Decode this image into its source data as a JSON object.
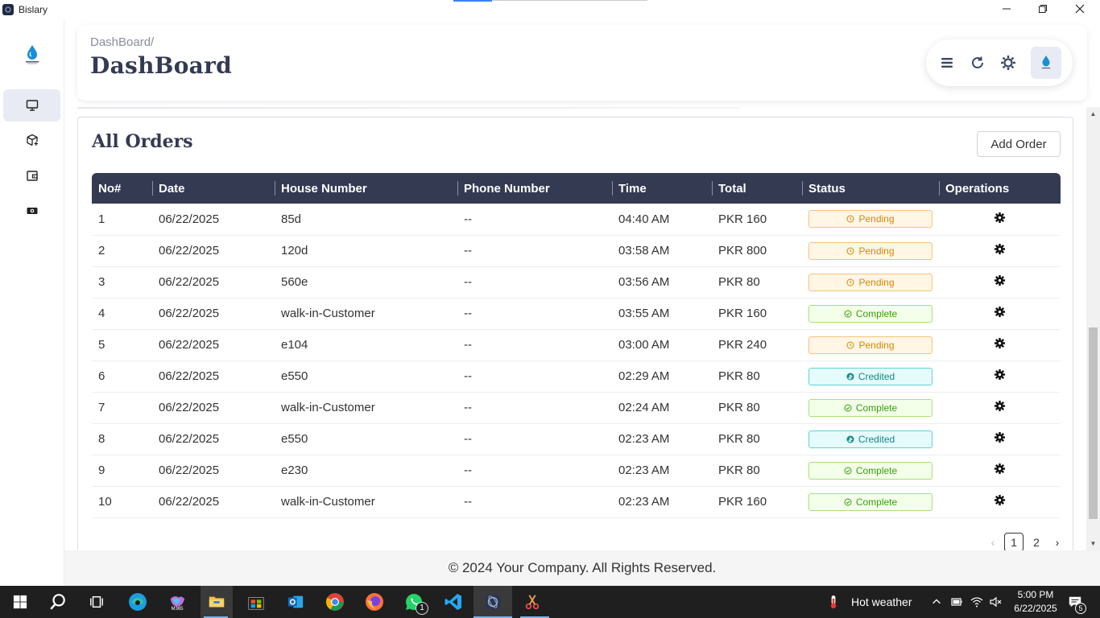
{
  "window": {
    "title": "Bislary"
  },
  "header": {
    "breadcrumb": "DashBoard/",
    "title": "DashBoard"
  },
  "orders": {
    "title": "All Orders",
    "add_button": "Add Order",
    "columns": [
      "No#",
      "Date",
      "House Number",
      "Phone Number",
      "Time",
      "Total",
      "Status",
      "Operations"
    ],
    "rows": [
      {
        "no": "1",
        "date": "06/22/2025",
        "house": "85d",
        "phone": "--",
        "time": "04:40 AM",
        "total": "PKR 160",
        "status": "Pending"
      },
      {
        "no": "2",
        "date": "06/22/2025",
        "house": "120d",
        "phone": "--",
        "time": "03:58 AM",
        "total": "PKR 800",
        "status": "Pending"
      },
      {
        "no": "3",
        "date": "06/22/2025",
        "house": "560e",
        "phone": "--",
        "time": "03:56 AM",
        "total": "PKR 80",
        "status": "Pending"
      },
      {
        "no": "4",
        "date": "06/22/2025",
        "house": "walk-in-Customer",
        "phone": "--",
        "time": "03:55 AM",
        "total": "PKR 160",
        "status": "Complete"
      },
      {
        "no": "5",
        "date": "06/22/2025",
        "house": "e104",
        "phone": "--",
        "time": "03:00 AM",
        "total": "PKR 240",
        "status": "Pending"
      },
      {
        "no": "6",
        "date": "06/22/2025",
        "house": "e550",
        "phone": "--",
        "time": "02:29 AM",
        "total": "PKR 80",
        "status": "Credited"
      },
      {
        "no": "7",
        "date": "06/22/2025",
        "house": "walk-in-Customer",
        "phone": "--",
        "time": "02:24 AM",
        "total": "PKR 80",
        "status": "Complete"
      },
      {
        "no": "8",
        "date": "06/22/2025",
        "house": "e550",
        "phone": "--",
        "time": "02:23 AM",
        "total": "PKR 80",
        "status": "Credited"
      },
      {
        "no": "9",
        "date": "06/22/2025",
        "house": "e230",
        "phone": "--",
        "time": "02:23 AM",
        "total": "PKR 80",
        "status": "Complete"
      },
      {
        "no": "10",
        "date": "06/22/2025",
        "house": "walk-in-Customer",
        "phone": "--",
        "time": "02:23 AM",
        "total": "PKR 160",
        "status": "Complete"
      }
    ]
  },
  "pagination": {
    "prev": "‹",
    "pages": [
      "1",
      "2"
    ],
    "current": "1",
    "next": "›"
  },
  "footer": {
    "text": "© 2024 Your Company. All Rights Reserved."
  },
  "taskbar": {
    "weather": "Hot weather",
    "time": "5:00 PM",
    "date": "6/22/2025",
    "whatsapp_badge": "1",
    "notification_count": "5",
    "m365_label": "M365"
  },
  "colors": {
    "primary_dark": "#343a52",
    "pending": "#d48806",
    "complete": "#389e0d",
    "credited": "#0e8a8a"
  }
}
